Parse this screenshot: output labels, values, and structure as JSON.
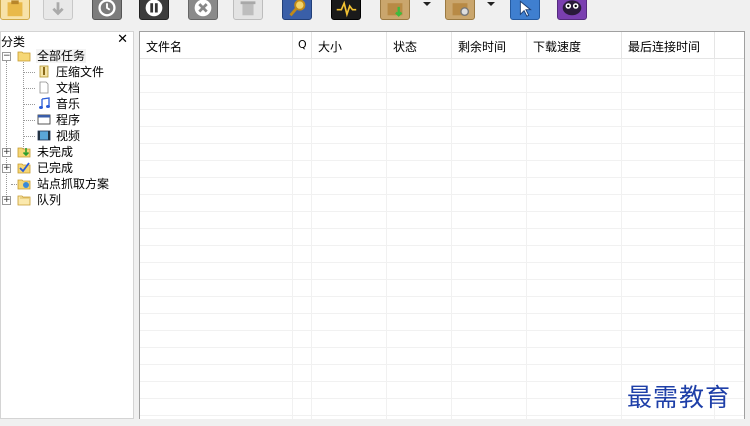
{
  "toolbar": {
    "buttons": [
      {
        "name": "clipboard-icon"
      },
      {
        "name": "download-icon"
      },
      {
        "name": "history-icon"
      },
      {
        "name": "pause-icon"
      },
      {
        "name": "stop-icon"
      },
      {
        "name": "recycle-bin-icon"
      },
      {
        "name": "search-icon"
      },
      {
        "name": "activity-monitor-icon"
      },
      {
        "name": "package-download-icon"
      },
      {
        "name": "package-settings-icon"
      },
      {
        "name": "cursor-icon"
      },
      {
        "name": "mascot-icon"
      }
    ]
  },
  "categories": {
    "title": "分类",
    "close_label": "✕",
    "all_tasks": "全部任务",
    "compressed": "压缩文件",
    "documents": "文档",
    "music": "音乐",
    "programs": "程序",
    "videos": "视频",
    "unfinished": "未完成",
    "finished": "已完成",
    "site_grab": "站点抓取方案",
    "queue": "队列"
  },
  "list": {
    "columns": [
      "文件名",
      "Q",
      "大小",
      "状态",
      "剩余时间",
      "下载速度",
      "最后连接时间"
    ]
  },
  "watermark": "最需教育"
}
